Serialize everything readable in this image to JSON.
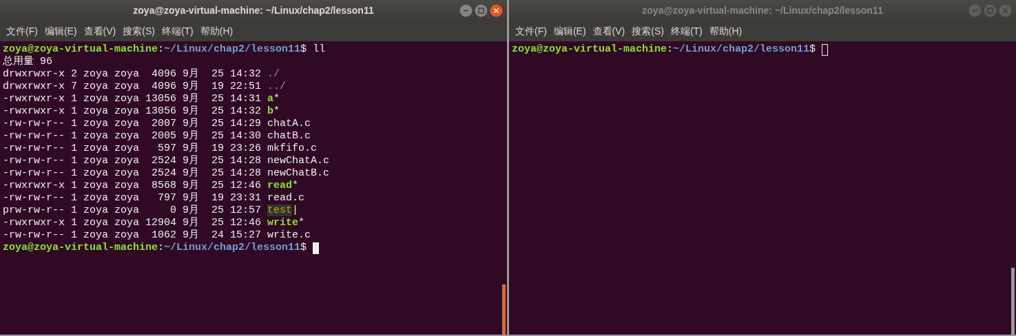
{
  "windows": [
    {
      "title": "zoya@zoya-virtual-machine: ~/Linux/chap2/lesson11",
      "focused": true,
      "menu": [
        "文件(F)",
        "编辑(E)",
        "查看(V)",
        "搜索(S)",
        "终端(T)",
        "帮助(H)"
      ],
      "lines": [
        {
          "kind": "prompt",
          "user": "zoya@zoya-virtual-machine",
          "separator": ":",
          "path": "~/Linux/chap2/lesson11",
          "symbol": "$",
          "command": " ll"
        },
        {
          "kind": "text",
          "text": "总用量 96"
        },
        {
          "kind": "dir_entry",
          "info": "drwxrwxr-x 2 zoya zoya  4096 9月  25 14:32 ",
          "name": "./"
        },
        {
          "kind": "dir_entry",
          "info": "drwxrwxr-x 7 zoya zoya  4096 9月  19 22:51 ",
          "name": "../"
        },
        {
          "kind": "exec_entry",
          "info": "-rwxrwxr-x 1 zoya zoya 13056 9月  25 14:31 ",
          "name": "a",
          "suffix": "*"
        },
        {
          "kind": "exec_entry",
          "info": "-rwxrwxr-x 1 zoya zoya 13056 9月  25 14:32 ",
          "name": "b",
          "suffix": "*"
        },
        {
          "kind": "file_entry",
          "info": "-rw-rw-r-- 1 zoya zoya  2007 9月  25 14:29 ",
          "name": "chatA.c"
        },
        {
          "kind": "file_entry",
          "info": "-rw-rw-r-- 1 zoya zoya  2005 9月  25 14:30 ",
          "name": "chatB.c"
        },
        {
          "kind": "file_entry",
          "info": "-rw-rw-r-- 1 zoya zoya   597 9月  19 23:26 ",
          "name": "mkfifo.c"
        },
        {
          "kind": "file_entry",
          "info": "-rw-rw-r-- 1 zoya zoya  2524 9月  25 14:28 ",
          "name": "newChatA.c"
        },
        {
          "kind": "file_entry",
          "info": "-rw-rw-r-- 1 zoya zoya  2524 9月  25 14:28 ",
          "name": "newChatB.c"
        },
        {
          "kind": "exec_entry",
          "info": "-rwxrwxr-x 1 zoya zoya  8568 9月  25 12:46 ",
          "name": "read",
          "suffix": "*"
        },
        {
          "kind": "file_entry",
          "info": "-rw-rw-r-- 1 zoya zoya   797 9月  19 23:31 ",
          "name": "read.c"
        },
        {
          "kind": "fifo_entry",
          "info": "prw-rw-r-- 1 zoya zoya     0 9月  25 12:57 ",
          "name": "test",
          "suffix": "|"
        },
        {
          "kind": "exec_entry",
          "info": "-rwxrwxr-x 1 zoya zoya 12904 9月  25 12:46 ",
          "name": "write",
          "suffix": "*"
        },
        {
          "kind": "file_entry",
          "info": "-rw-rw-r-- 1 zoya zoya  1062 9月  24 15:27 ",
          "name": "write.c"
        },
        {
          "kind": "prompt",
          "user": "zoya@zoya-virtual-machine",
          "separator": ":",
          "path": "~/Linux/chap2/lesson11",
          "symbol": "$ ",
          "cursor": true
        }
      ]
    },
    {
      "title": "zoya@zoya-virtual-machine: ~/Linux/chap2/lesson11",
      "focused": false,
      "menu": [
        "文件(F)",
        "编辑(E)",
        "查看(V)",
        "搜索(S)",
        "终端(T)",
        "帮助(H)"
      ],
      "lines": [
        {
          "kind": "prompt",
          "user": "zoya@zoya-virtual-machine",
          "separator": ":",
          "path": "~/Linux/chap2/lesson11",
          "symbol": "$ ",
          "cursor": true
        }
      ]
    }
  ]
}
